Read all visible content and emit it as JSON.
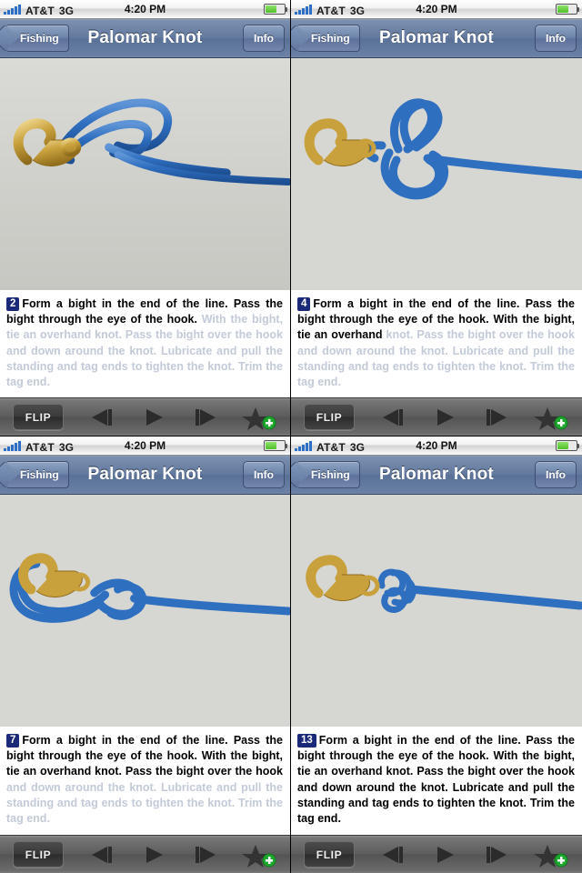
{
  "app": {
    "title": "Palomar Knot",
    "back_label": "Fishing",
    "info_label": "Info"
  },
  "statusbar": {
    "carrier": "AT&T",
    "network": "3G",
    "time": "4:20 PM",
    "signal_bars": 5,
    "battery_percent": 62,
    "signal_icon": "signal-bars-icon",
    "battery_icon": "battery-icon"
  },
  "toolbar": {
    "flip_label": "FLIP",
    "prev_icon": "step-backward-icon",
    "play_icon": "play-icon",
    "next_icon": "step-forward-icon",
    "favorite_icon": "star-add-icon"
  },
  "instruction": {
    "sentences": [
      "Form a bight in the end of the line.",
      "Pass the bight through the eye of the hook.",
      "With the bight, tie an overhand knot.",
      "Pass the bight over the hook and down around the knot.",
      "Lubricate and pull the standing and tag ends to tighten the knot.",
      "Trim the tag end."
    ],
    "full_text": "Form a bight in the end of the line. Pass the bight through the eye of the hook. With the bight, tie an overhand knot. Pass the bight over the hook and down around the knot. Lubricate and pull the standing and tag ends to tighten the knot. Trim the tag end."
  },
  "panels": [
    {
      "step_number": "2",
      "active_text": "Form a bight in the end of the line. Pass the bight through the eye of the hook.",
      "dim_text": " With the bight, tie an overhand knot. Pass the bight over the hook and down around the knot. Lubricate and pull the standing and tag ends to tighten the knot. Trim the tag end.",
      "photo_caption": "open bight beside hook eye"
    },
    {
      "step_number": "4",
      "active_text": "Form a bight in the end of the line. Pass the bight through the eye of the hook. With the bight, tie an overhand",
      "dim_text": " knot. Pass the bight over the hook and down around the knot. Lubricate and pull the standing and tag ends to tighten the knot. Trim the tag end.",
      "photo_caption": "loose overhand knot tied with bight"
    },
    {
      "step_number": "7",
      "active_text": "Form a bight in the end of the line. Pass the bight through the eye of the hook. With the bight, tie an overhand knot. Pass the bight over the hook",
      "dim_text": " and down around the knot. Lubricate and pull the standing and tag ends to tighten the knot. Trim the tag end.",
      "photo_caption": "bight passed over the hook"
    },
    {
      "step_number": "13",
      "active_text": "Form a bight in the end of the line. Pass the bight through the eye of the hook. With the bight, tie an overhand knot. Pass the bight over the hook and down around the knot. Lubricate and pull the standing and tag ends to tighten the knot. Trim the tag end.",
      "dim_text": "",
      "photo_caption": "finished tightened palomar knot"
    }
  ],
  "colors": {
    "navbar_blue": "#5a7197",
    "badge_navy": "#1b2a78",
    "dim_text": "#c3cad8",
    "active_text": "#000000",
    "rope_blue": "#2f6fc0",
    "hook_brass": "#c9a13c",
    "toolbar_gray": "#5d5d5d",
    "accent_green": "#1fa82e",
    "signal_blue": "#2b6fc6"
  }
}
